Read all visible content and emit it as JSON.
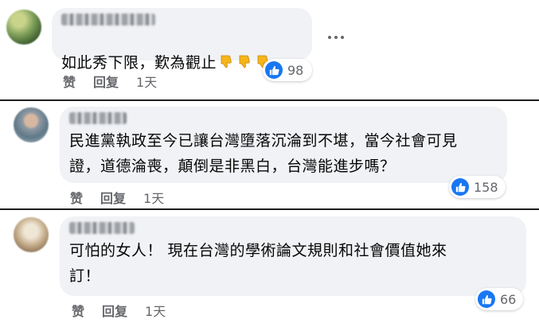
{
  "comments": [
    {
      "text": "如此秀下限，歎為觀止",
      "emoji_icons": [
        "thumbs-down-icon",
        "thumbs-down-icon",
        "thumbs-down-icon"
      ],
      "reaction_count": "98",
      "like_label": "赞",
      "reply_label": "回复",
      "timestamp": "1天"
    },
    {
      "text": "民進黨執政至今已讓台灣墮落沉淪到不堪，當今社會可見\n證，道德淪喪，顛倒是非黑白，台灣能進步嗎？",
      "reaction_count": "158",
      "like_label": "赞",
      "reply_label": "回复",
      "timestamp": "1天"
    },
    {
      "text": "可怕的女人！ 現在台灣的學術論文規則和社會價值她來\n訂！",
      "reaction_count": "66",
      "like_label": "赞",
      "reply_label": "回复",
      "timestamp": "1天"
    }
  ],
  "colors": {
    "bubble": "#f0f2f5",
    "like_blue": "#1877f2",
    "secondary_text": "#65676b",
    "divider": "#1c1e21"
  }
}
